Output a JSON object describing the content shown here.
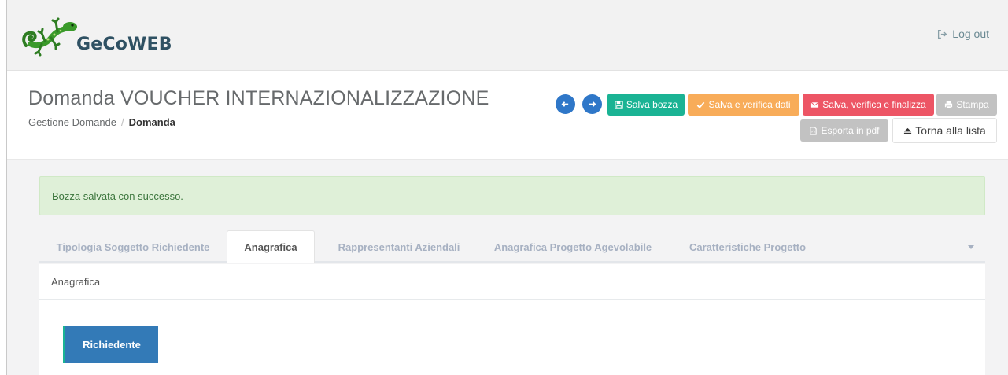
{
  "app": {
    "brand": "GeCoWEB",
    "logout_label": "Log out"
  },
  "header": {
    "title": "Domanda VOUCHER INTERNAZIONALIZZAZIONE",
    "breadcrumb": [
      "Gestione Domande",
      "Domanda"
    ]
  },
  "toolbar": {
    "prev_icon": "arrow-left-icon",
    "next_icon": "arrow-right-icon",
    "salva_bozza": "Salva bozza",
    "salva_verifica": "Salva e verifica dati",
    "salva_finalizza": "Salva, verifica e finalizza",
    "stampa": "Stampa",
    "esporta_pdf": "Esporta in pdf",
    "torna_lista": "Torna alla lista"
  },
  "alert": {
    "message": "Bozza salvata con successo."
  },
  "tabs": [
    {
      "label": "Tipologia Soggetto Richiedente",
      "active": false
    },
    {
      "label": "Anagrafica",
      "active": true
    },
    {
      "label": "Rappresentanti Aziendali",
      "active": false
    },
    {
      "label": "Anagrafica Progetto Agevolabile",
      "active": false
    },
    {
      "label": "Caratteristiche Progetto",
      "active": false
    }
  ],
  "panel": {
    "title": "Anagrafica",
    "section_button": "Richiedente"
  },
  "colors": {
    "primary": "#2f77c8",
    "success": "#1ab394",
    "warning": "#f8ac59",
    "danger": "#ed5565",
    "muted": "#c2c2c2",
    "alert_bg": "#dff0d8",
    "alert_text": "#3c763d",
    "section_button": "#337ab7"
  }
}
